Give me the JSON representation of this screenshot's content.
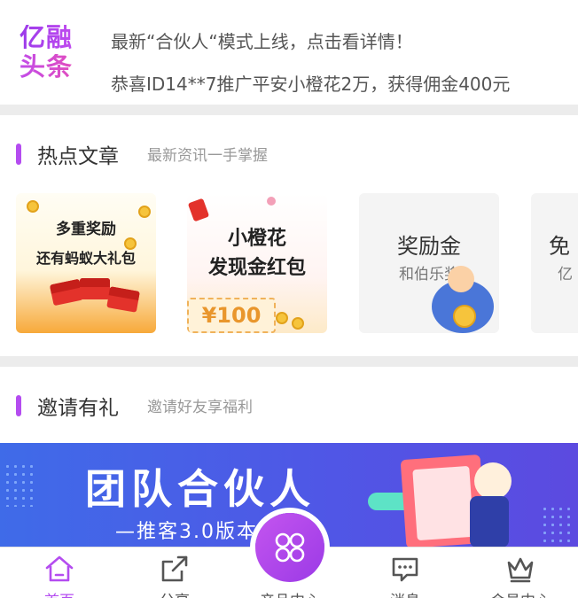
{
  "headline": {
    "logo_line1": "亿融",
    "logo_line2": "头条",
    "news": [
      "最新“合伙人“模式上线，点击看详情！",
      "恭喜ID14**7推广平安小橙花2万，获得佣金400元"
    ]
  },
  "hot_articles": {
    "title": "热点文章",
    "subtitle": "最新资讯一手掌握",
    "items": [
      {
        "line1": "多重奖励",
        "line2": "还有蚂蚁大礼包"
      },
      {
        "line1": "小橙花",
        "line2": "发现金红包",
        "badge": "¥100"
      },
      {
        "line1": "奖励金",
        "line2": "和伯乐奖"
      },
      {
        "line1": "免",
        "line2": "亿"
      }
    ]
  },
  "invite": {
    "title": "邀请有礼",
    "subtitle": "邀请好友享福利",
    "banner_title": "团队合伙人",
    "banner_sub": "—推客3.0版本"
  },
  "tabbar": {
    "tabs": [
      {
        "label": "首页",
        "icon": "home-icon"
      },
      {
        "label": "分享",
        "icon": "share-icon"
      },
      {
        "label": "产品中心",
        "icon": "apps-icon"
      },
      {
        "label": "消息",
        "icon": "message-icon"
      },
      {
        "label": "会员中心",
        "icon": "crown-icon"
      }
    ]
  },
  "colors": {
    "accent": "#b44cf0",
    "banner_blue": "#4f57e6"
  }
}
